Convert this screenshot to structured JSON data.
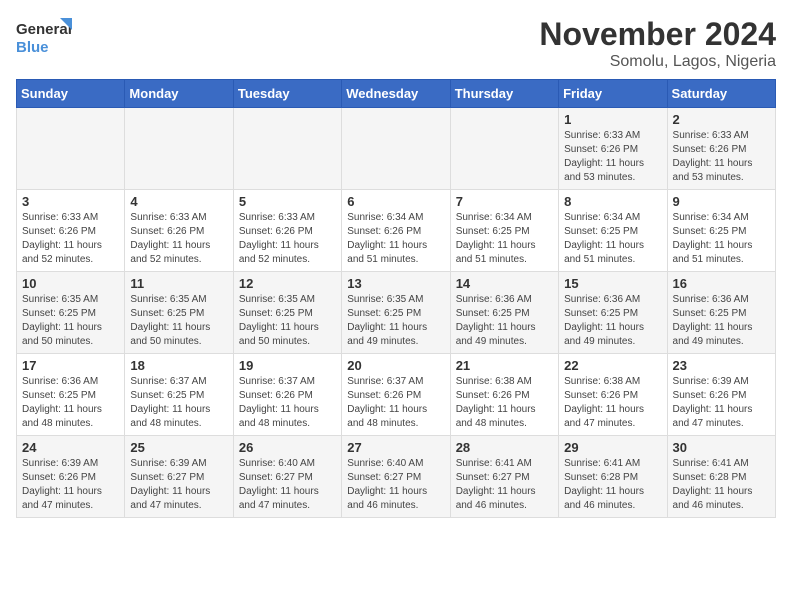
{
  "header": {
    "logo_line1": "General",
    "logo_line2": "Blue",
    "month": "November 2024",
    "location": "Somolu, Lagos, Nigeria"
  },
  "weekdays": [
    "Sunday",
    "Monday",
    "Tuesday",
    "Wednesday",
    "Thursday",
    "Friday",
    "Saturday"
  ],
  "weeks": [
    [
      {
        "day": "",
        "info": ""
      },
      {
        "day": "",
        "info": ""
      },
      {
        "day": "",
        "info": ""
      },
      {
        "day": "",
        "info": ""
      },
      {
        "day": "",
        "info": ""
      },
      {
        "day": "1",
        "info": "Sunrise: 6:33 AM\nSunset: 6:26 PM\nDaylight: 11 hours\nand 53 minutes."
      },
      {
        "day": "2",
        "info": "Sunrise: 6:33 AM\nSunset: 6:26 PM\nDaylight: 11 hours\nand 53 minutes."
      }
    ],
    [
      {
        "day": "3",
        "info": "Sunrise: 6:33 AM\nSunset: 6:26 PM\nDaylight: 11 hours\nand 52 minutes."
      },
      {
        "day": "4",
        "info": "Sunrise: 6:33 AM\nSunset: 6:26 PM\nDaylight: 11 hours\nand 52 minutes."
      },
      {
        "day": "5",
        "info": "Sunrise: 6:33 AM\nSunset: 6:26 PM\nDaylight: 11 hours\nand 52 minutes."
      },
      {
        "day": "6",
        "info": "Sunrise: 6:34 AM\nSunset: 6:26 PM\nDaylight: 11 hours\nand 51 minutes."
      },
      {
        "day": "7",
        "info": "Sunrise: 6:34 AM\nSunset: 6:25 PM\nDaylight: 11 hours\nand 51 minutes."
      },
      {
        "day": "8",
        "info": "Sunrise: 6:34 AM\nSunset: 6:25 PM\nDaylight: 11 hours\nand 51 minutes."
      },
      {
        "day": "9",
        "info": "Sunrise: 6:34 AM\nSunset: 6:25 PM\nDaylight: 11 hours\nand 51 minutes."
      }
    ],
    [
      {
        "day": "10",
        "info": "Sunrise: 6:35 AM\nSunset: 6:25 PM\nDaylight: 11 hours\nand 50 minutes."
      },
      {
        "day": "11",
        "info": "Sunrise: 6:35 AM\nSunset: 6:25 PM\nDaylight: 11 hours\nand 50 minutes."
      },
      {
        "day": "12",
        "info": "Sunrise: 6:35 AM\nSunset: 6:25 PM\nDaylight: 11 hours\nand 50 minutes."
      },
      {
        "day": "13",
        "info": "Sunrise: 6:35 AM\nSunset: 6:25 PM\nDaylight: 11 hours\nand 49 minutes."
      },
      {
        "day": "14",
        "info": "Sunrise: 6:36 AM\nSunset: 6:25 PM\nDaylight: 11 hours\nand 49 minutes."
      },
      {
        "day": "15",
        "info": "Sunrise: 6:36 AM\nSunset: 6:25 PM\nDaylight: 11 hours\nand 49 minutes."
      },
      {
        "day": "16",
        "info": "Sunrise: 6:36 AM\nSunset: 6:25 PM\nDaylight: 11 hours\nand 49 minutes."
      }
    ],
    [
      {
        "day": "17",
        "info": "Sunrise: 6:36 AM\nSunset: 6:25 PM\nDaylight: 11 hours\nand 48 minutes."
      },
      {
        "day": "18",
        "info": "Sunrise: 6:37 AM\nSunset: 6:25 PM\nDaylight: 11 hours\nand 48 minutes."
      },
      {
        "day": "19",
        "info": "Sunrise: 6:37 AM\nSunset: 6:26 PM\nDaylight: 11 hours\nand 48 minutes."
      },
      {
        "day": "20",
        "info": "Sunrise: 6:37 AM\nSunset: 6:26 PM\nDaylight: 11 hours\nand 48 minutes."
      },
      {
        "day": "21",
        "info": "Sunrise: 6:38 AM\nSunset: 6:26 PM\nDaylight: 11 hours\nand 48 minutes."
      },
      {
        "day": "22",
        "info": "Sunrise: 6:38 AM\nSunset: 6:26 PM\nDaylight: 11 hours\nand 47 minutes."
      },
      {
        "day": "23",
        "info": "Sunrise: 6:39 AM\nSunset: 6:26 PM\nDaylight: 11 hours\nand 47 minutes."
      }
    ],
    [
      {
        "day": "24",
        "info": "Sunrise: 6:39 AM\nSunset: 6:26 PM\nDaylight: 11 hours\nand 47 minutes."
      },
      {
        "day": "25",
        "info": "Sunrise: 6:39 AM\nSunset: 6:27 PM\nDaylight: 11 hours\nand 47 minutes."
      },
      {
        "day": "26",
        "info": "Sunrise: 6:40 AM\nSunset: 6:27 PM\nDaylight: 11 hours\nand 47 minutes."
      },
      {
        "day": "27",
        "info": "Sunrise: 6:40 AM\nSunset: 6:27 PM\nDaylight: 11 hours\nand 46 minutes."
      },
      {
        "day": "28",
        "info": "Sunrise: 6:41 AM\nSunset: 6:27 PM\nDaylight: 11 hours\nand 46 minutes."
      },
      {
        "day": "29",
        "info": "Sunrise: 6:41 AM\nSunset: 6:28 PM\nDaylight: 11 hours\nand 46 minutes."
      },
      {
        "day": "30",
        "info": "Sunrise: 6:41 AM\nSunset: 6:28 PM\nDaylight: 11 hours\nand 46 minutes."
      }
    ]
  ]
}
